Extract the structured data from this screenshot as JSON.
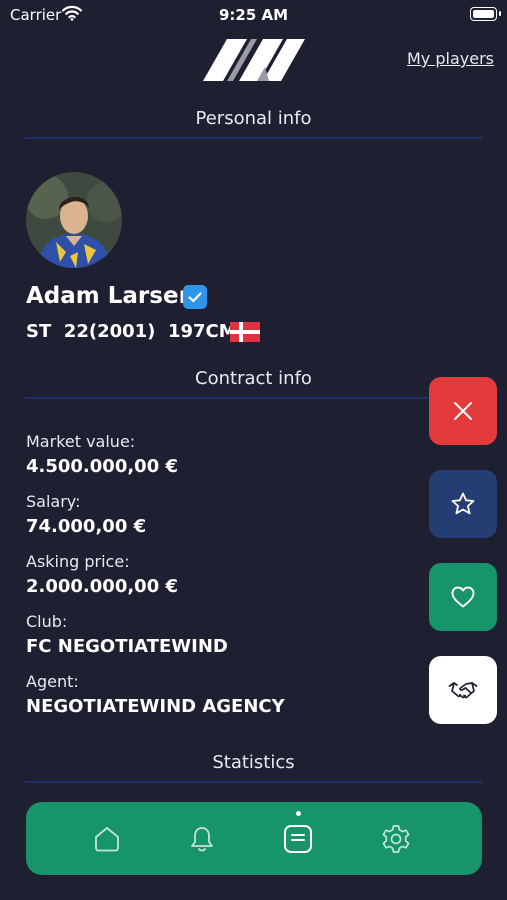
{
  "status_bar": {
    "carrier": "Carrier",
    "time": "9:25 AM"
  },
  "header": {
    "my_players_link": "My players"
  },
  "sections": {
    "personal_info": "Personal info",
    "contract_info": "Contract info",
    "statistics": "Statistics"
  },
  "player": {
    "name": "Adam Larsen",
    "verified": true,
    "position": "ST",
    "age_birth": "22(2001)",
    "height": "197CM",
    "nationality_flag": "denmark-flag"
  },
  "contract": [
    {
      "label": "Market value:",
      "value": "4.500.000,00 €"
    },
    {
      "label": "Salary:",
      "value": "74.000,00 €"
    },
    {
      "label": "Asking price:",
      "value": "2.000.000,00 €"
    },
    {
      "label": "Club:",
      "value": "FC NEGOTIATEWIND"
    },
    {
      "label": "Agent:",
      "value": "NEGOTIATEWIND AGENCY"
    }
  ],
  "actions": [
    {
      "icon": "close-icon",
      "color": "#e33b3b"
    },
    {
      "icon": "star-icon",
      "color": "#243d72"
    },
    {
      "icon": "heart-icon",
      "color": "#17946a"
    },
    {
      "icon": "handshake-icon",
      "color": "#ffffff"
    }
  ],
  "bottom_nav": {
    "items": [
      "home-icon",
      "bell-icon",
      "document-icon",
      "gear-icon"
    ],
    "active_index": 2
  },
  "colors": {
    "background": "#1e2031",
    "accent_green": "#17946a",
    "divider_blue": "#1d3166",
    "verified_blue": "#2e95e8"
  }
}
